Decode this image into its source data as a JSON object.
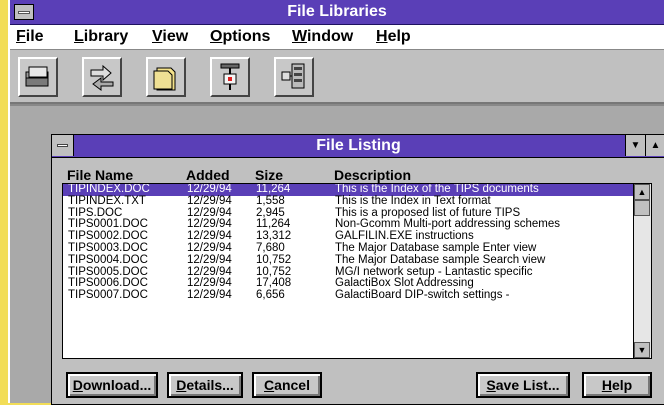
{
  "window": {
    "title": "File Libraries"
  },
  "menu": [
    "File",
    "Library",
    "View",
    "Options",
    "Window",
    "Help"
  ],
  "toolbar": [
    "card-file-icon",
    "swap-icon",
    "folder-stack-icon",
    "connector-icon",
    "network-icon"
  ],
  "child": {
    "title": "File Listing",
    "scroll_up": "▲",
    "scroll_down": "▼",
    "columns": [
      "File Name",
      "Added",
      "Size",
      "Description"
    ],
    "rows": [
      [
        "TIPINDEX.DOC",
        "12/29/94",
        "11,264",
        "This is the Index of the TIPS documents"
      ],
      [
        "TIPINDEX.TXT",
        "12/29/94",
        "1,558",
        "This is the Index in Text format"
      ],
      [
        "TIPS.DOC",
        "12/29/94",
        "2,945",
        "This is a proposed list of future TIPS"
      ],
      [
        "TIPS0001.DOC",
        "12/29/94",
        "11,264",
        "Non-Gcomm Multi-port addressing schemes"
      ],
      [
        "TIPS0002.DOC",
        "12/29/94",
        "13,312",
        "GALFILIN.EXE instructions"
      ],
      [
        "TIPS0003.DOC",
        "12/29/94",
        "7,680",
        "The Major Database sample Enter view"
      ],
      [
        "TIPS0004.DOC",
        "12/29/94",
        "10,752",
        "The Major Database sample Search view"
      ],
      [
        "TIPS0005.DOC",
        "12/29/94",
        "10,752",
        "MG/I network setup - Lantastic specific"
      ],
      [
        "TIPS0006.DOC",
        "12/29/94",
        "17,408",
        "GalactiBox Slot Addressing"
      ],
      [
        "TIPS0007.DOC",
        "12/29/94",
        "6,656",
        "GalactiBoard DIP-switch settings -"
      ]
    ],
    "buttons": {
      "download": "Download...",
      "details": "Details...",
      "cancel": "Cancel",
      "save_list": "Save List...",
      "help": "Help"
    }
  },
  "colors": {
    "titlebar": "#5a3fb7",
    "background": "#f2dd57",
    "selection": "#5a3fb7"
  }
}
